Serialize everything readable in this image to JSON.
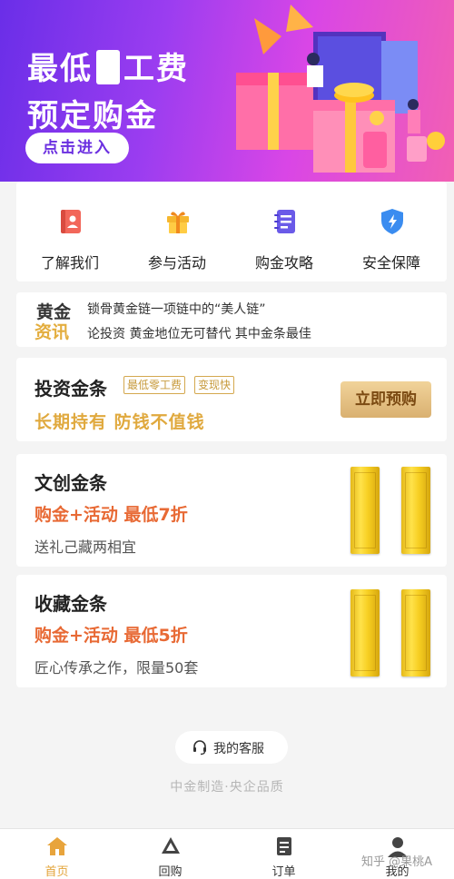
{
  "banner": {
    "line1_pre": "最低",
    "line1_post": "工费",
    "line2": "预定购金",
    "cta": "点击进入"
  },
  "quick_nav": [
    {
      "label": "了解我们",
      "icon": "book-icon"
    },
    {
      "label": "参与活动",
      "icon": "gift-icon"
    },
    {
      "label": "购金攻略",
      "icon": "notebook-icon"
    },
    {
      "label": "安全保障",
      "icon": "shield-icon"
    }
  ],
  "news": {
    "badge_top": "黄金",
    "badge_bottom": "资讯",
    "lines": [
      "锁骨黄金链一项链中的“美人链”",
      "论投资   黄金地位无可替代   其中金条最佳"
    ]
  },
  "products": [
    {
      "title": "投资金条",
      "tags": [
        "最低零工费",
        "变现快"
      ],
      "subtitle": "长期持有   防钱不值钱",
      "button": "立即预购"
    },
    {
      "title": "文创金条",
      "promo": "购金+活动  最低7折",
      "desc": "送礼己藏两相宜"
    },
    {
      "title": "收藏金条",
      "promo": "购金+活动  最低5折",
      "desc": "匠心传承之作，限量50套"
    }
  ],
  "service": {
    "label": "我的客服",
    "icon": "headset-icon"
  },
  "slogan": "中金制造·央企品质",
  "tabbar": [
    {
      "label": "首页",
      "icon": "home-icon",
      "active": true
    },
    {
      "label": "回购",
      "icon": "recycle-icon",
      "active": false
    },
    {
      "label": "订单",
      "icon": "order-icon",
      "active": false
    },
    {
      "label": "我的",
      "icon": "user-icon",
      "active": false
    }
  ],
  "watermark": "知乎 @果桃A",
  "colors": {
    "accent_gold": "#e0a93e",
    "promo_orange": "#e86a35",
    "banner_purple": "#6a2ee8",
    "banner_pink": "#f25fb3"
  }
}
